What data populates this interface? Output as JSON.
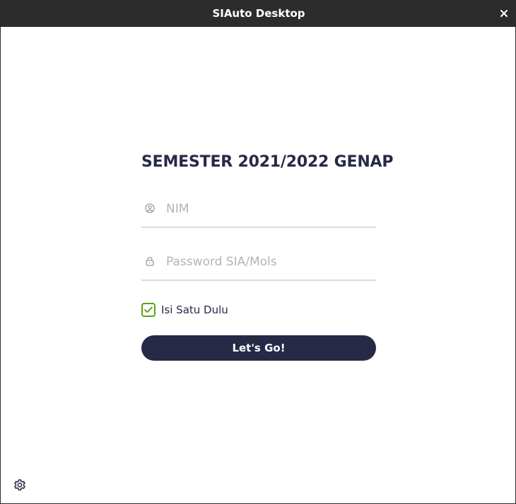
{
  "window": {
    "title": "SIAuto Desktop",
    "close_icon": "close-icon"
  },
  "login": {
    "heading": "SEMESTER 2021/2022 GENAP",
    "nim": {
      "placeholder": "NIM",
      "value": "",
      "icon": "user-circle-icon"
    },
    "password": {
      "placeholder": "Password SIA/Mols",
      "value": "",
      "icon": "lock-icon"
    },
    "remember": {
      "label": "Isi Satu Dulu",
      "checked": true
    },
    "submit_label": "Let's Go!"
  },
  "footer": {
    "settings_icon": "gear-icon"
  },
  "colors": {
    "titlebar": "#2c2c2c",
    "primary": "#262a47",
    "check": "#5ba30f",
    "placeholder": "#b4b4b4",
    "divider": "#dcdcdc"
  }
}
